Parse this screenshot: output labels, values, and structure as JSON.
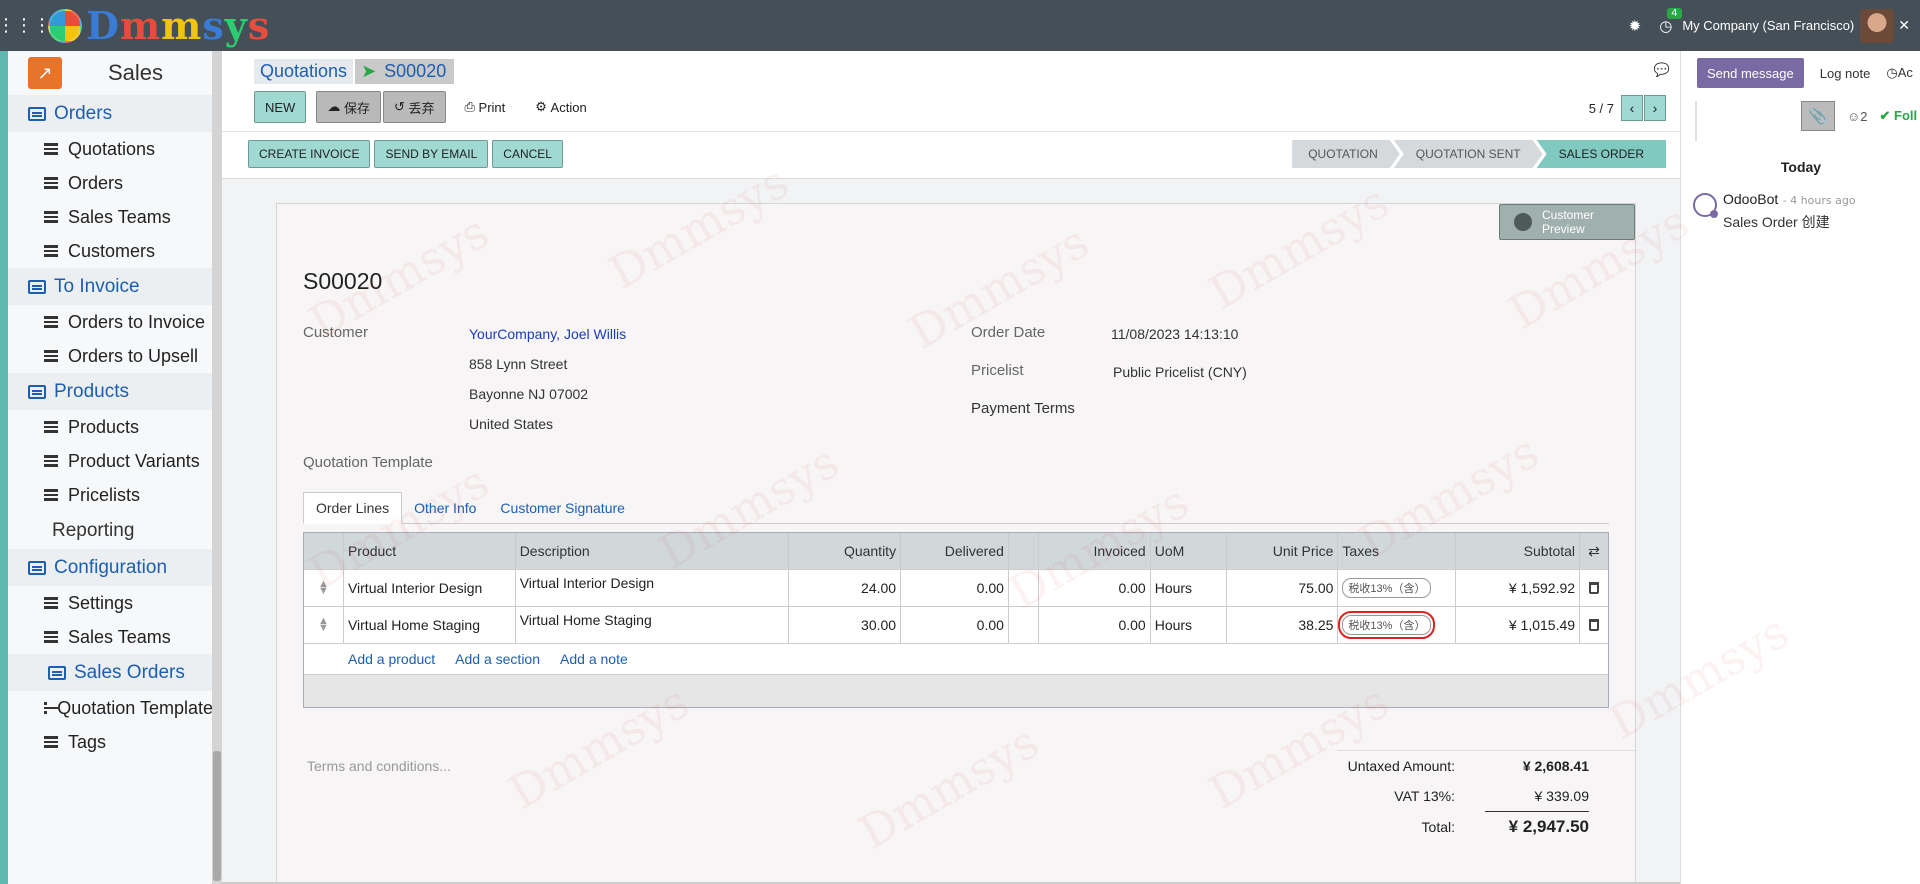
{
  "topbar": {
    "brand": [
      "D",
      "m",
      "m",
      "s",
      "y",
      "s"
    ],
    "activity_count": "4",
    "company": "My Company (San Francisco)"
  },
  "sidebar": {
    "app_title": "Sales",
    "items": [
      {
        "type": "section",
        "label": "Orders"
      },
      {
        "type": "item",
        "label": "Quotations"
      },
      {
        "type": "item",
        "label": "Orders"
      },
      {
        "type": "item",
        "label": "Sales Teams"
      },
      {
        "type": "item",
        "label": "Customers"
      },
      {
        "type": "section",
        "label": "To Invoice"
      },
      {
        "type": "item",
        "label": "Orders to Invoice"
      },
      {
        "type": "item",
        "label": "Orders to Upsell"
      },
      {
        "type": "section",
        "label": "Products"
      },
      {
        "type": "item",
        "label": "Products"
      },
      {
        "type": "item",
        "label": "Product Variants"
      },
      {
        "type": "item",
        "label": "Pricelists"
      },
      {
        "type": "plain",
        "label": "Reporting"
      },
      {
        "type": "section",
        "label": "Configuration"
      },
      {
        "type": "item",
        "label": "Settings"
      },
      {
        "type": "item",
        "label": "Sales Teams"
      },
      {
        "type": "subsection",
        "label": "Sales Orders"
      },
      {
        "type": "item",
        "label": "Quotation Templates"
      },
      {
        "type": "item",
        "label": "Tags"
      }
    ]
  },
  "breadcrumb": {
    "parent": "Quotations",
    "current": "S00020"
  },
  "toolbar": {
    "new_label": "NEW",
    "save_label": "保存",
    "discard_label": "丢弃",
    "print_label": "Print",
    "action_label": "Action"
  },
  "pager": {
    "value": "5 / 7"
  },
  "status_buttons": {
    "create_invoice": "CREATE INVOICE",
    "send_email": "SEND BY EMAIL",
    "cancel": "CANCEL"
  },
  "stages": [
    {
      "label": "QUOTATION",
      "active": false
    },
    {
      "label": "QUOTATION SENT",
      "active": false
    },
    {
      "label": "SALES ORDER",
      "active": true
    }
  ],
  "form": {
    "preview_label": "Customer Preview",
    "name": "S00020",
    "customer_label": "Customer",
    "customer_name": "YourCompany, Joel Willis",
    "address_line1": "858 Lynn Street",
    "address_line2": "Bayonne NJ 07002",
    "address_line3": "United States",
    "order_date_label": "Order Date",
    "order_date": "11/08/2023 14:13:10",
    "pricelist_label": "Pricelist",
    "pricelist": "Public Pricelist (CNY)",
    "payment_terms_label": "Payment Terms",
    "template_label": "Quotation Template"
  },
  "tabs": [
    "Order Lines",
    "Other Info",
    "Customer Signature"
  ],
  "order_lines": {
    "headers": [
      "Product",
      "Description",
      "Quantity",
      "Delivered",
      "Invoiced",
      "UoM",
      "Unit Price",
      "Taxes",
      "Subtotal"
    ],
    "rows": [
      {
        "product": "Virtual Interior Design",
        "description": "Virtual Interior Design",
        "quantity": "24.00",
        "delivered": "0.00",
        "invoiced": "0.00",
        "uom": "Hours",
        "unit_price": "75.00",
        "tax": "税收13%（含）",
        "subtotal": "¥ 1,592.92"
      },
      {
        "product": "Virtual Home Staging",
        "description": "Virtual Home Staging",
        "quantity": "30.00",
        "delivered": "0.00",
        "invoiced": "0.00",
        "uom": "Hours",
        "unit_price": "38.25",
        "tax": "税收13%（含）",
        "subtotal": "¥ 1,015.49"
      }
    ],
    "add_product": "Add a product",
    "add_section": "Add a section",
    "add_note": "Add a note"
  },
  "terms_placeholder": "Terms and conditions...",
  "totals": {
    "untaxed_label": "Untaxed Amount:",
    "untaxed": "¥ 2,608.41",
    "vat_label": "VAT 13%:",
    "vat": "¥ 339.09",
    "total_label": "Total:",
    "total": "¥ 2,947.50"
  },
  "chatter": {
    "send_message": "Send message",
    "log_note": "Log note",
    "activity": "Ac",
    "followers_count": "2",
    "follow": "Foll",
    "today": "Today",
    "author": "OdooBot",
    "time": "- 4 hours ago",
    "body": "Sales Order 创建"
  },
  "watermark": "Dmmsys"
}
